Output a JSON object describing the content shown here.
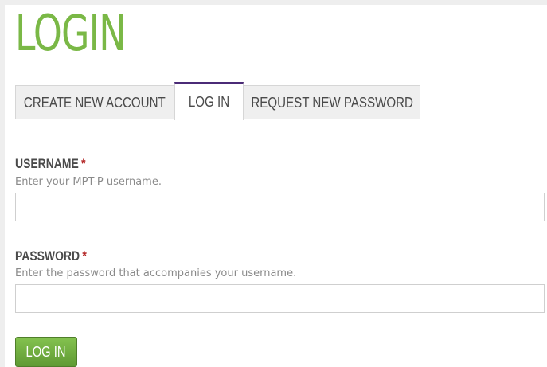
{
  "page": {
    "title": "LOGIN"
  },
  "tabs": [
    {
      "label": "CREATE NEW ACCOUNT",
      "active": false
    },
    {
      "label": "LOG IN",
      "active": true
    },
    {
      "label": "REQUEST NEW PASSWORD",
      "active": false
    }
  ],
  "form": {
    "username": {
      "label": "USERNAME",
      "required_marker": "*",
      "description": "Enter your MPT-P username.",
      "value": ""
    },
    "password": {
      "label": "PASSWORD",
      "required_marker": "*",
      "description": "Enter the password that accompanies your username.",
      "value": ""
    },
    "submit_label": "LOG IN"
  },
  "colors": {
    "title": "#7ab846",
    "active_tab_border": "#4b2b77",
    "required": "#b22222",
    "button": "#6aa83a"
  }
}
